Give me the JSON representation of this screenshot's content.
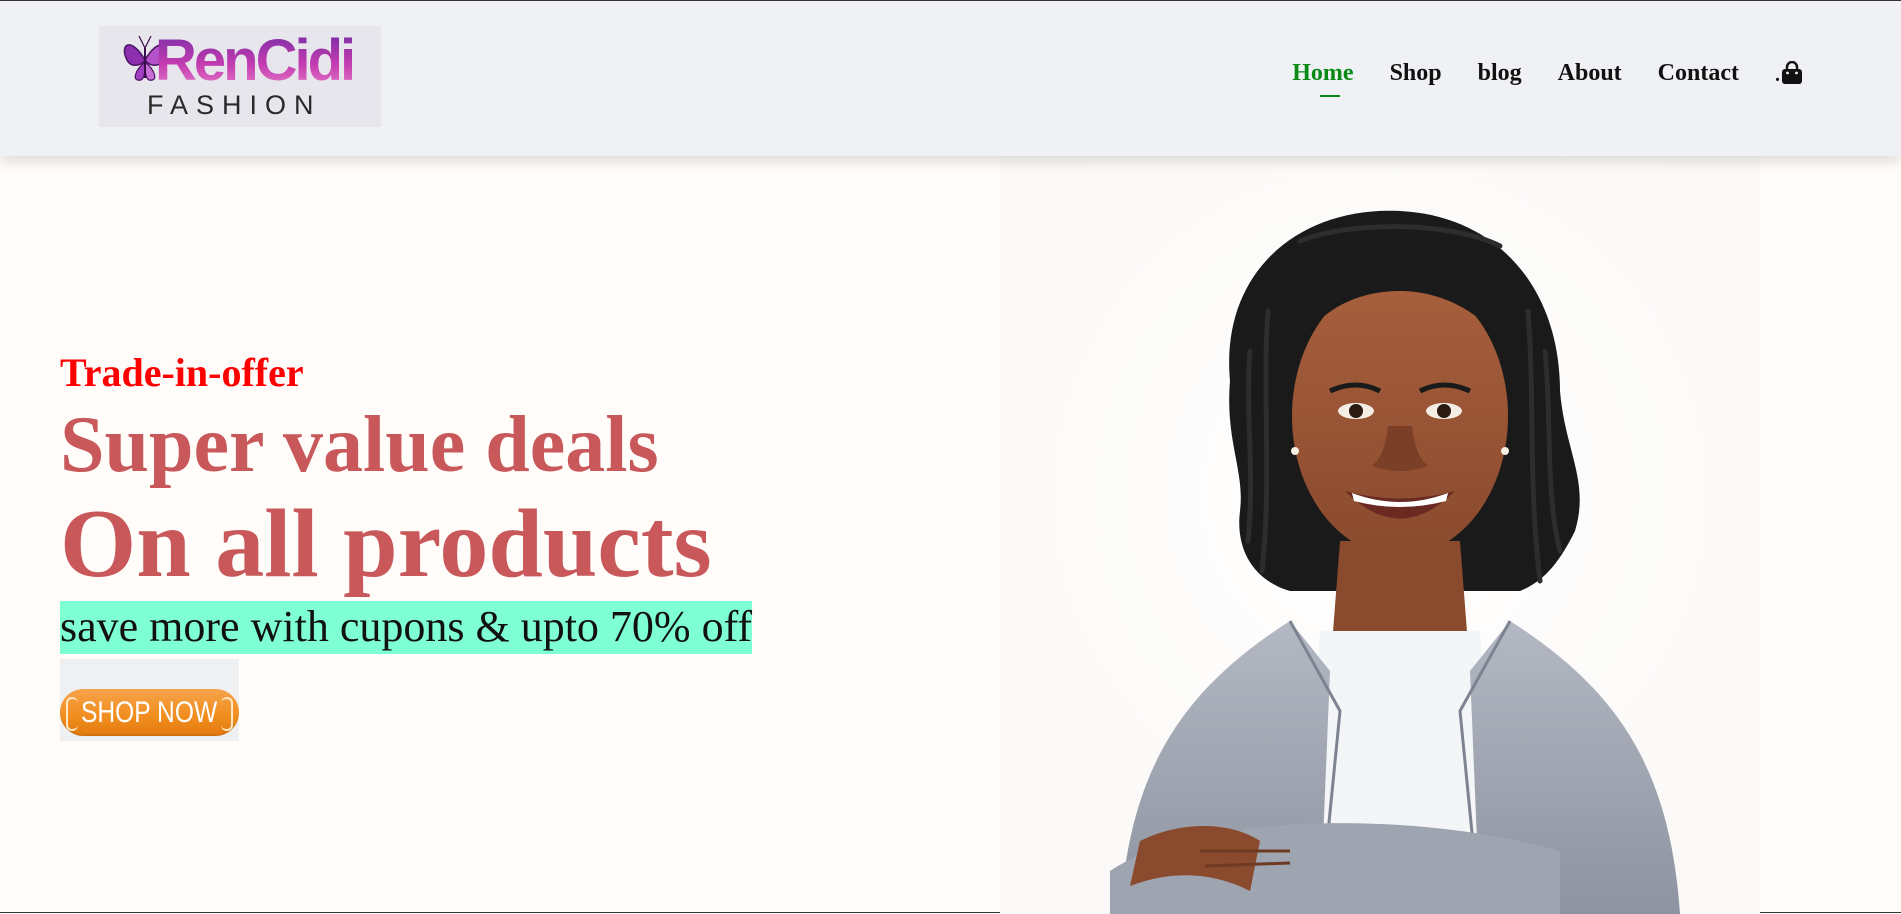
{
  "header": {
    "logo": {
      "word": "RenCidi",
      "sub": "FASHION"
    },
    "nav": [
      {
        "label": "Home",
        "active": true
      },
      {
        "label": "Shop"
      },
      {
        "label": "blog"
      },
      {
        "label": "About"
      },
      {
        "label": "Contact"
      }
    ],
    "cart_prefix": "."
  },
  "hero": {
    "eyebrow": "Trade-in-offer",
    "line1": "Super value deals",
    "line2": "On all products",
    "tagline": "save more with cupons & upto 70% off",
    "button_label": "SHOP NOW"
  },
  "colors": {
    "header_bg": "#eff1f4",
    "nav_active": "#088a14",
    "eyebrow": "#ff0000",
    "headline": "#c8585a",
    "tagline_highlight": "#7fffd4",
    "button": "#f08d1d"
  },
  "icons": [
    "butterfly-icon",
    "shopping-bag-icon"
  ]
}
